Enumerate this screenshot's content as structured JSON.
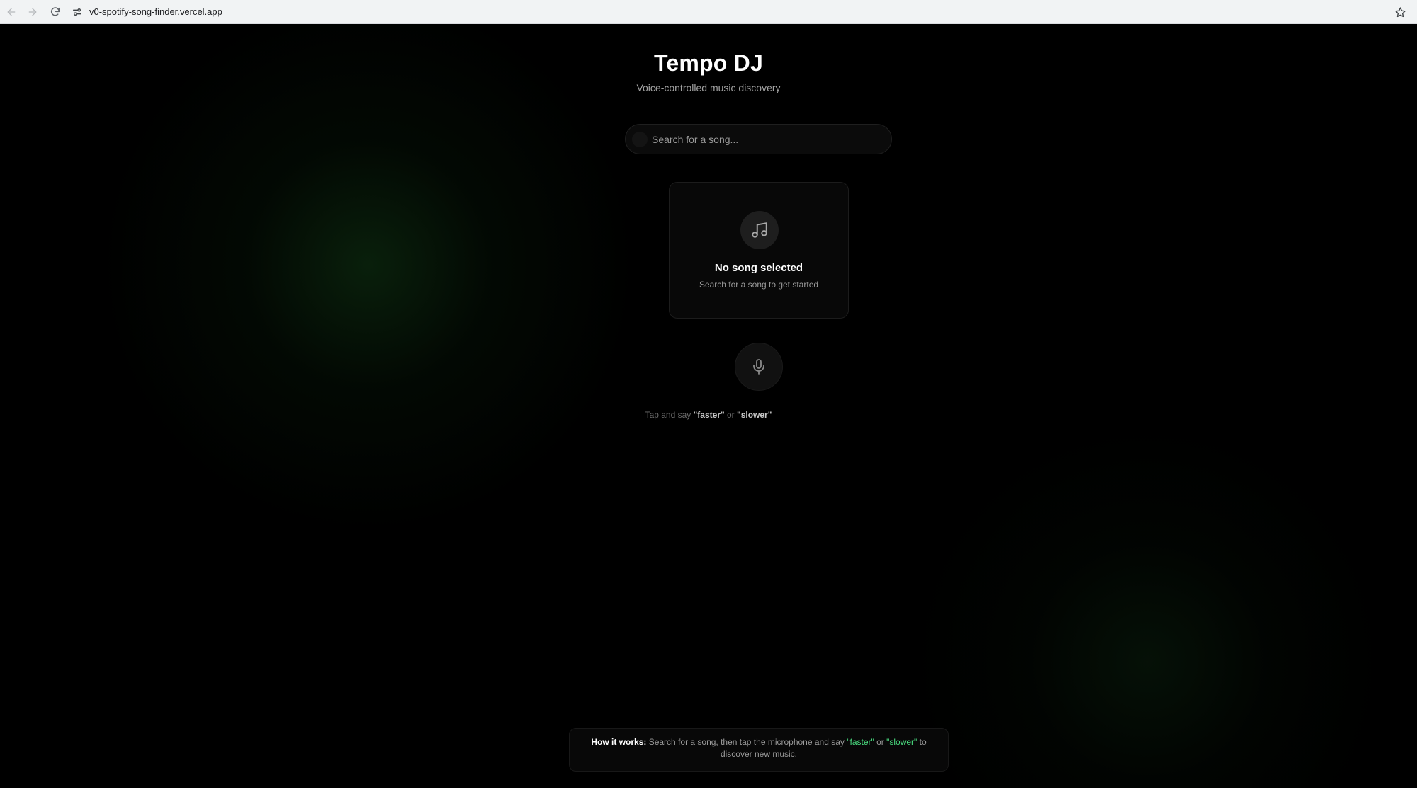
{
  "browser": {
    "url": "v0-spotify-song-finder.vercel.app"
  },
  "header": {
    "title": "Tempo DJ",
    "subtitle": "Voice-controlled music discovery"
  },
  "search": {
    "placeholder": "Search for a song...",
    "value": ""
  },
  "song_card": {
    "icon": "music-note-icon",
    "title": "No song selected",
    "subtitle": "Search for a song to get started"
  },
  "mic": {
    "icon": "microphone-icon",
    "hint_prefix": "Tap and say ",
    "hint_word_faster": "\"faster\"",
    "hint_or": " or ",
    "hint_word_slower": "\"slower\""
  },
  "how_it_works": {
    "lead": "How it works:",
    "text_1": " Search for a song, then tap the microphone and say ",
    "faster": "\"faster\"",
    "or": " or ",
    "slower": "\"slower\"",
    "text_2": " to discover new music."
  },
  "colors": {
    "accent_green": "#4ade80",
    "background": "#000000"
  }
}
